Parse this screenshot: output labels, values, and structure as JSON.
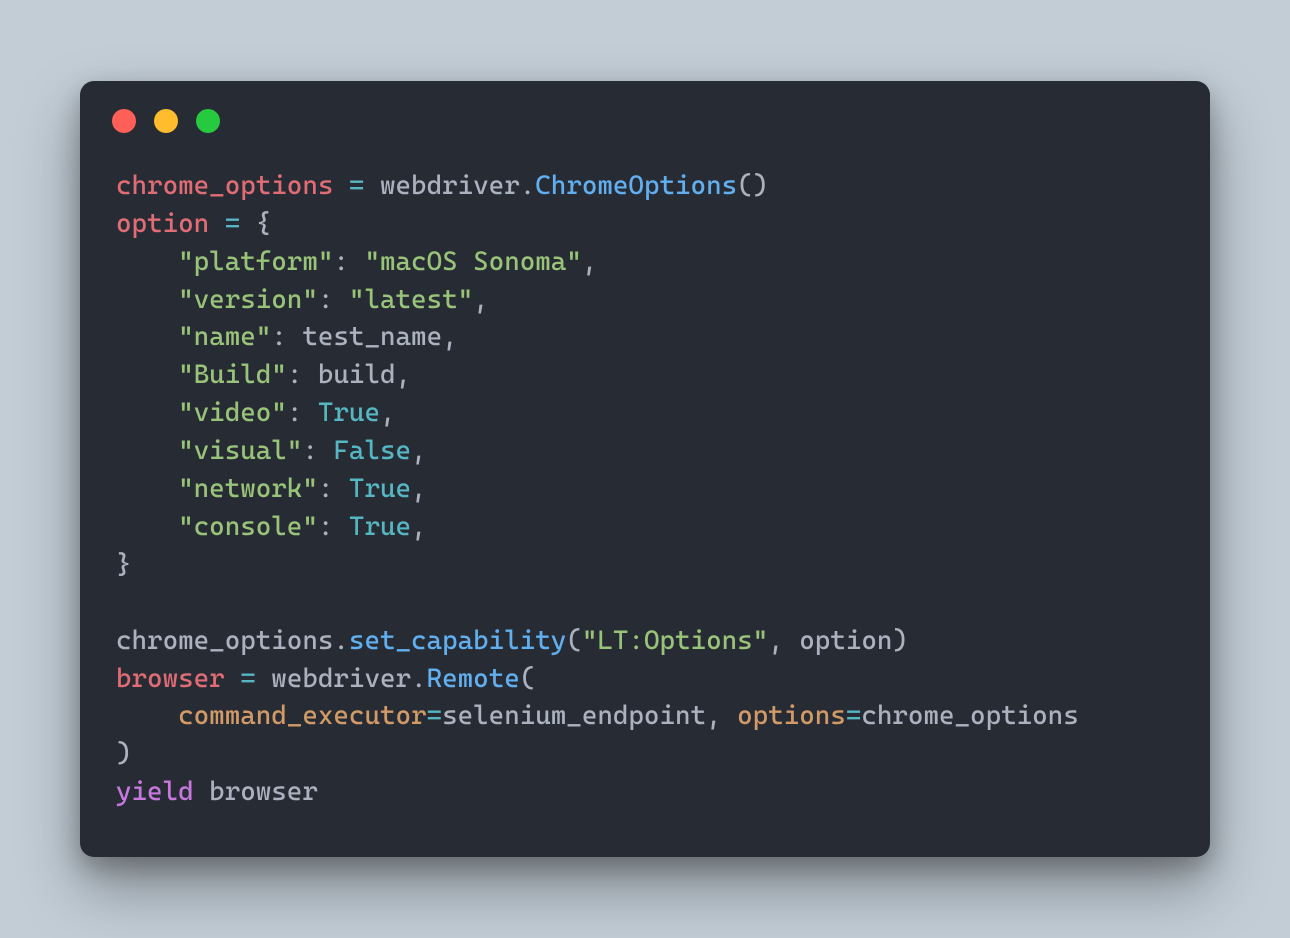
{
  "code": {
    "line1": {
      "var": "chrome_options",
      "eq": " = ",
      "mod": "webdriver",
      "dot": ".",
      "cls": "ChromeOptions",
      "call": "()"
    },
    "line2": {
      "var": "option",
      "eq": " = ",
      "brace": "{"
    },
    "opt_platform": {
      "key": "\"platform\"",
      "colon": ": ",
      "val": "\"macOS Sonoma\"",
      "comma": ","
    },
    "opt_version": {
      "key": "\"version\"",
      "colon": ": ",
      "val": "\"latest\"",
      "comma": ","
    },
    "opt_name": {
      "key": "\"name\"",
      "colon": ": ",
      "val": "test_name",
      "comma": ","
    },
    "opt_build": {
      "key": "\"Build\"",
      "colon": ": ",
      "val": "build",
      "comma": ","
    },
    "opt_video": {
      "key": "\"video\"",
      "colon": ": ",
      "val": "True",
      "comma": ","
    },
    "opt_visual": {
      "key": "\"visual\"",
      "colon": ": ",
      "val": "False",
      "comma": ","
    },
    "opt_network": {
      "key": "\"network\"",
      "colon": ": ",
      "val": "True",
      "comma": ","
    },
    "opt_console": {
      "key": "\"console\"",
      "colon": ": ",
      "val": "True",
      "comma": ","
    },
    "close_brace": "}",
    "setcap": {
      "obj": "chrome_options",
      "dot": ".",
      "fn": "set_capability",
      "open": "(",
      "arg1": "\"LT:Options\"",
      "sep": ", ",
      "arg2": "option",
      "close": ")"
    },
    "browser_assign": {
      "var": "browser",
      "eq": " = ",
      "mod": "webdriver",
      "dot": ".",
      "cls": "Remote",
      "open": "("
    },
    "remote_args": {
      "kw1": "command_executor",
      "eq1": "=",
      "val1": "selenium_endpoint",
      "sep": ", ",
      "kw2": "options",
      "eq2": "=",
      "val2": "chrome_options"
    },
    "close_paren": ")",
    "yield": {
      "kw": "yield",
      "sp": " ",
      "var": "browser"
    }
  }
}
